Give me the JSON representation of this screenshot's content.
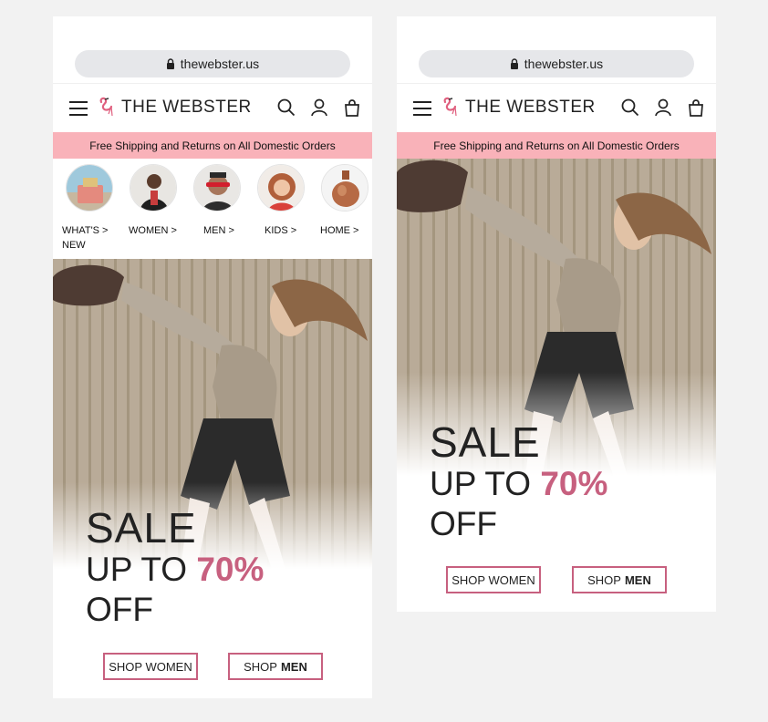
{
  "browser": {
    "url": "thewebster.us"
  },
  "header": {
    "brand": "THE WEBSTER"
  },
  "promo": {
    "text": "Free Shipping and Returns on All Domestic Orders"
  },
  "categories": [
    {
      "line1": "WHAT'S >",
      "line2": "NEW"
    },
    {
      "line1": "WOMEN >",
      "line2": ""
    },
    {
      "line1": "MEN >",
      "line2": ""
    },
    {
      "line1": "KIDS >",
      "line2": ""
    },
    {
      "line1": "HOME >",
      "line2": ""
    }
  ],
  "hero": {
    "sale": "SALE",
    "upto": "UP TO",
    "percent": "70%",
    "off": "OFF"
  },
  "buttons": {
    "shop_women": "SHOP WOMEN",
    "shop_men_prefix": "SHOP",
    "shop_men_bold": "MEN"
  },
  "colors": {
    "accent": "#c7607f",
    "promo_bg": "#f9b2b9",
    "background": "#f2f2f2"
  }
}
